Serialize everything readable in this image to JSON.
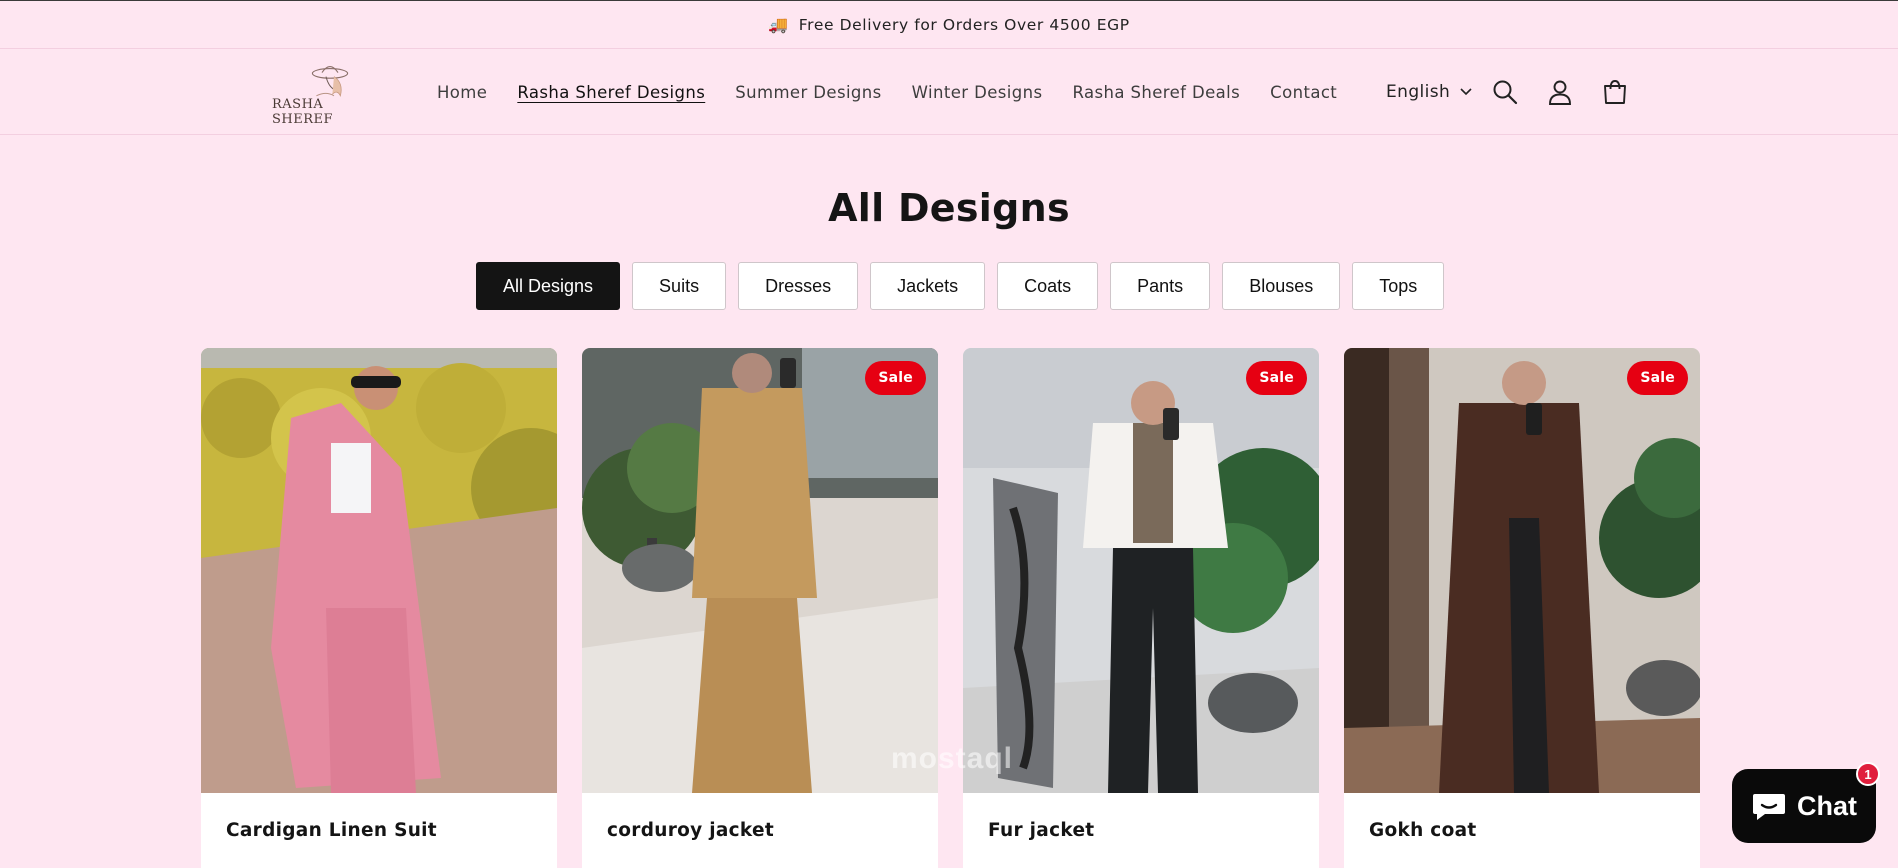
{
  "announcement": {
    "text": "Free Delivery for Orders Over 4500 EGP",
    "icon": "truck-icon"
  },
  "header": {
    "logo_text": "RASHA SHEREF",
    "nav": [
      {
        "label": "Home",
        "active": false
      },
      {
        "label": "Rasha Sheref Designs",
        "active": true
      },
      {
        "label": "Summer Designs",
        "active": false
      },
      {
        "label": "Winter Designs",
        "active": false
      },
      {
        "label": "Rasha Sheref Deals",
        "active": false
      },
      {
        "label": "Contact",
        "active": false
      }
    ],
    "language": "English",
    "icons": [
      "search-icon",
      "account-icon",
      "cart-icon"
    ]
  },
  "page": {
    "title": "All Designs",
    "filters": [
      "All Designs",
      "Suits",
      "Dresses",
      "Jackets",
      "Coats",
      "Pants",
      "Blouses",
      "Tops"
    ],
    "selected_filter": "All Designs"
  },
  "products": [
    {
      "name": "Cardigan Linen Suit",
      "badge": ""
    },
    {
      "name": "corduroy jacket",
      "badge": "Sale"
    },
    {
      "name": "Fur jacket",
      "badge": "Sale"
    },
    {
      "name": "Gokh coat",
      "badge": "Sale"
    }
  ],
  "watermark": "mostaql",
  "chat": {
    "label": "Chat",
    "badge_count": "1"
  },
  "colors": {
    "background": "#fee6f1",
    "selected_chip": "#141414",
    "sale_badge": "#e60012",
    "chat_button": "#0a0a0a"
  }
}
